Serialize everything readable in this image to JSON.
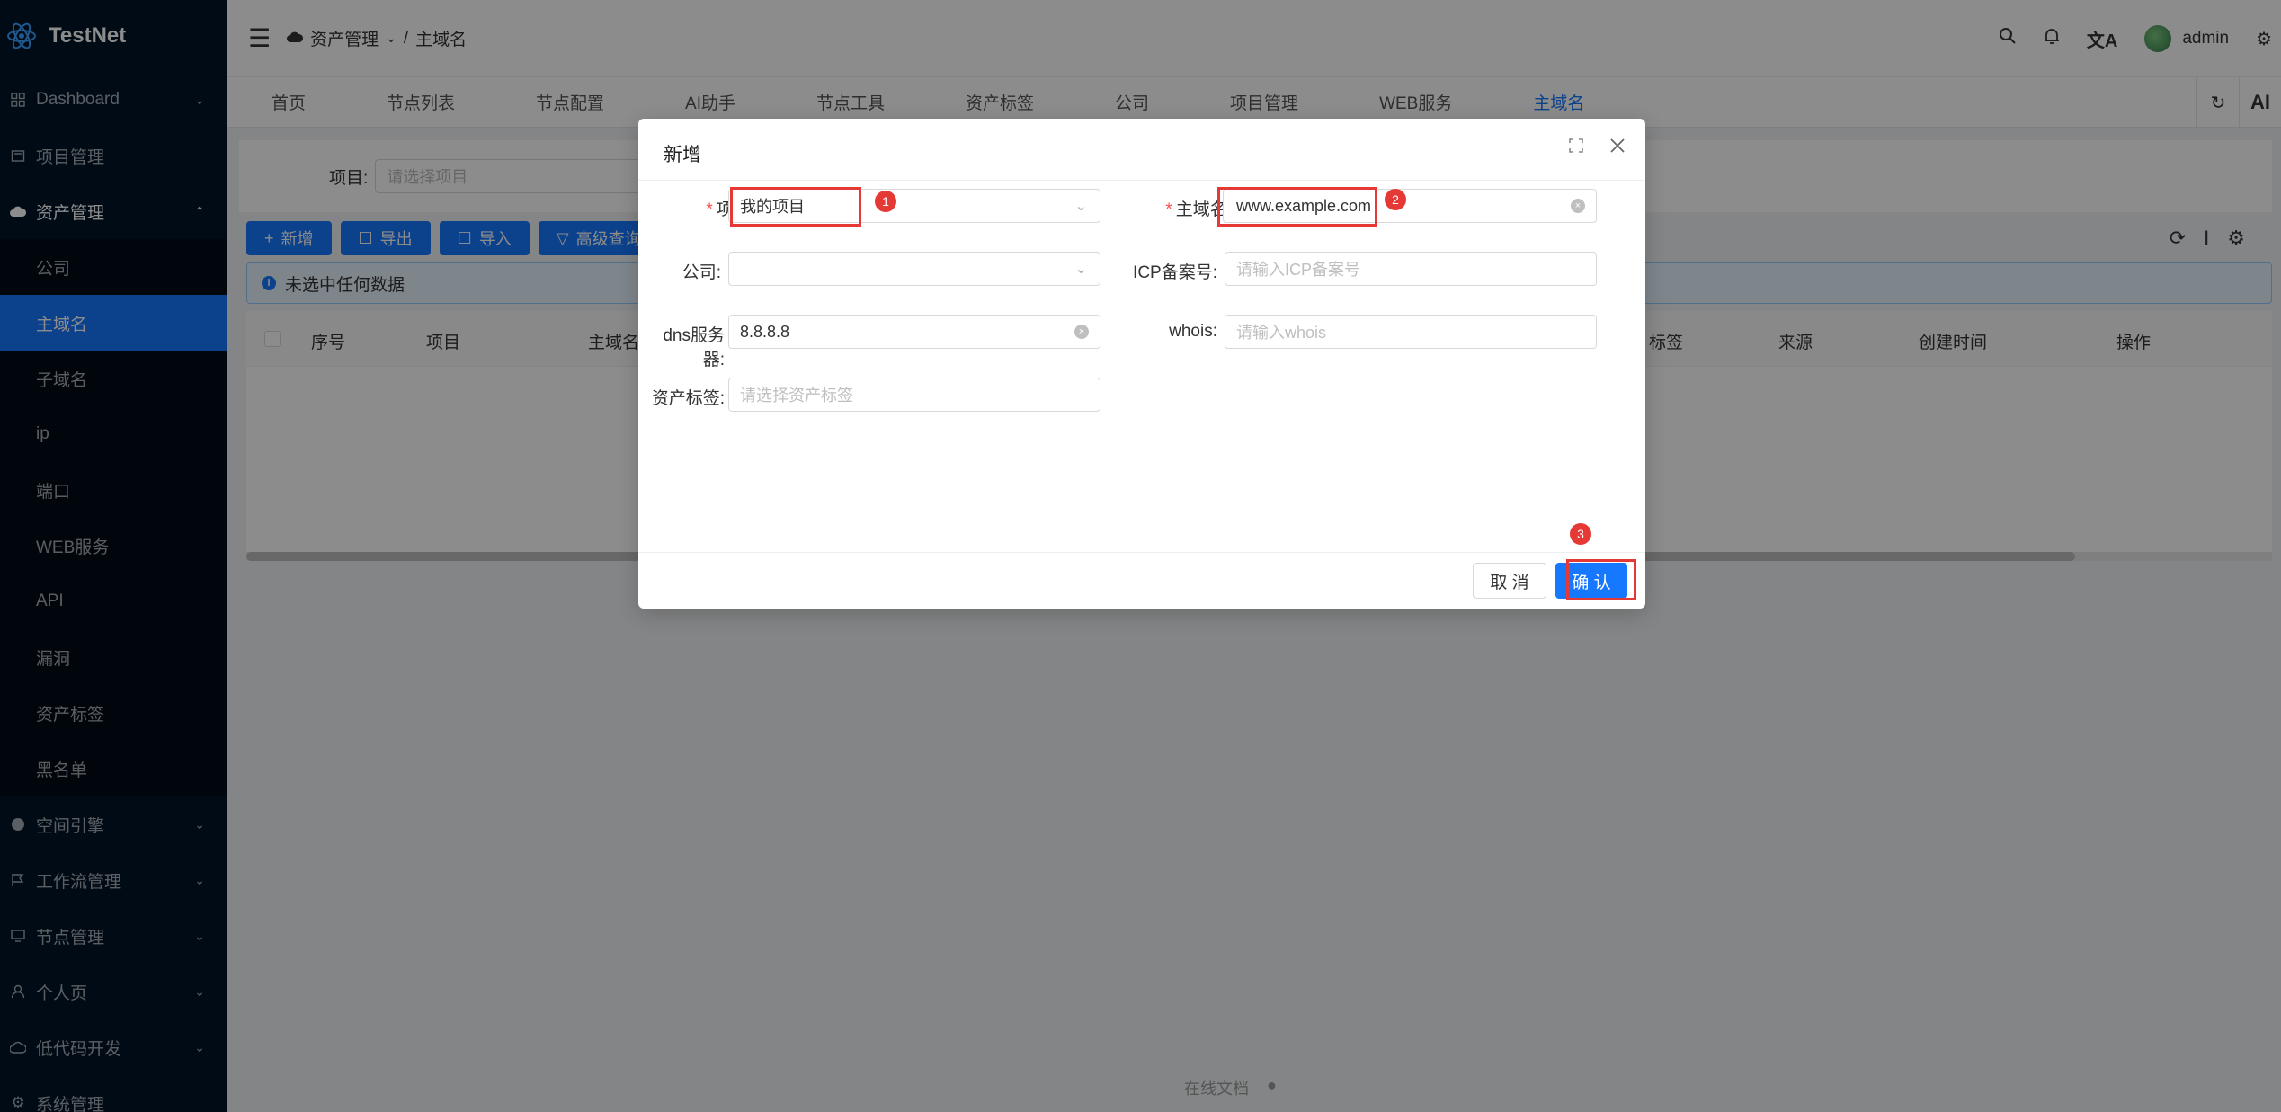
{
  "app": {
    "name": "TestNet"
  },
  "sidebar": {
    "items": [
      {
        "label": "Dashboard",
        "icon": "grid-icon",
        "has_children": true
      },
      {
        "label": "项目管理",
        "icon": "folder-icon",
        "has_children": false
      },
      {
        "label": "资产管理",
        "icon": "cloud-icon",
        "has_children": true,
        "expanded": true,
        "children": [
          "公司",
          "主域名",
          "子域名",
          "ip",
          "端口",
          "WEB服务",
          "API",
          "漏洞",
          "资产标签",
          "黑名单"
        ],
        "active_child": "主域名"
      },
      {
        "label": "空间引擎",
        "icon": "globe-icon",
        "has_children": true
      },
      {
        "label": "工作流管理",
        "icon": "flag-icon",
        "has_children": true
      },
      {
        "label": "节点管理",
        "icon": "monitor-icon",
        "has_children": true
      },
      {
        "label": "个人页",
        "icon": "user-icon",
        "has_children": true
      },
      {
        "label": "低代码开发",
        "icon": "cloud-outline-icon",
        "has_children": true
      },
      {
        "label": "系统管理",
        "icon": "gear-icon",
        "has_children": true
      }
    ]
  },
  "header": {
    "breadcrumb": [
      "资产管理",
      "主域名"
    ],
    "user": "admin"
  },
  "tabs": {
    "items": [
      "首页",
      "节点列表",
      "节点配置",
      "AI助手",
      "节点工具",
      "资产标签",
      "公司",
      "项目管理",
      "WEB服务",
      "主域名"
    ],
    "active": "主域名",
    "right_label": "AI"
  },
  "page": {
    "search": {
      "label": "项目:",
      "placeholder": "请选择项目"
    },
    "toolbar": [
      "新增",
      "导出",
      "导入",
      "高级查询"
    ],
    "alert": "未选中任何数据",
    "table_headers": [
      "序号",
      "项目",
      "主域名",
      "标签",
      "来源",
      "创建时间",
      "操作"
    ],
    "footer": {
      "docs": "在线文档"
    }
  },
  "modal": {
    "title": "新增",
    "fields": {
      "project": {
        "label": "项目:",
        "value": "我的项目",
        "required": true
      },
      "domain": {
        "label": "主域名:",
        "value": "www.example.com",
        "required": true
      },
      "company": {
        "label": "公司:",
        "value": ""
      },
      "icp": {
        "label": "ICP备案号:",
        "placeholder": "请输入ICP备案号"
      },
      "dns": {
        "label": "dns服务器:",
        "value": "8.8.8.8"
      },
      "whois": {
        "label": "whois:",
        "placeholder": "请输入whois"
      },
      "tags": {
        "label": "资产标签:",
        "placeholder": "请选择资产标签"
      }
    },
    "cancel_label": "取 消",
    "ok_label": "确 认",
    "annotations": [
      "1",
      "2",
      "3"
    ],
    "highlight_color": "#e53935"
  },
  "colors": {
    "primary": "#1677ff",
    "sidebar_bg": "#001529"
  }
}
